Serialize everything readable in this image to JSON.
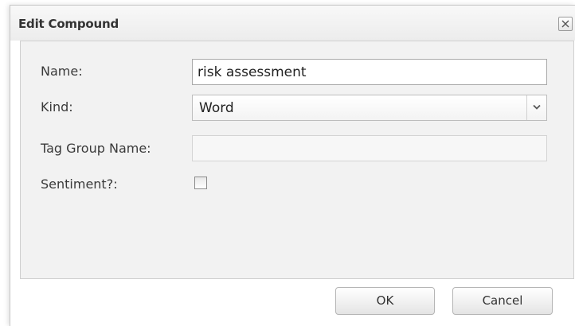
{
  "dialog": {
    "title": "Edit Compound",
    "close_icon": "close-icon"
  },
  "form": {
    "name_label": "Name:",
    "name_value": "risk assessment",
    "kind_label": "Kind:",
    "kind_value": "Word",
    "kind_arrow_icon": "chevron-down-icon",
    "tag_group_label": "Tag Group Name:",
    "tag_group_value": "",
    "sentiment_label": "Sentiment?:",
    "sentiment_checked": false
  },
  "buttons": {
    "ok_label": "OK",
    "cancel_label": "Cancel"
  }
}
